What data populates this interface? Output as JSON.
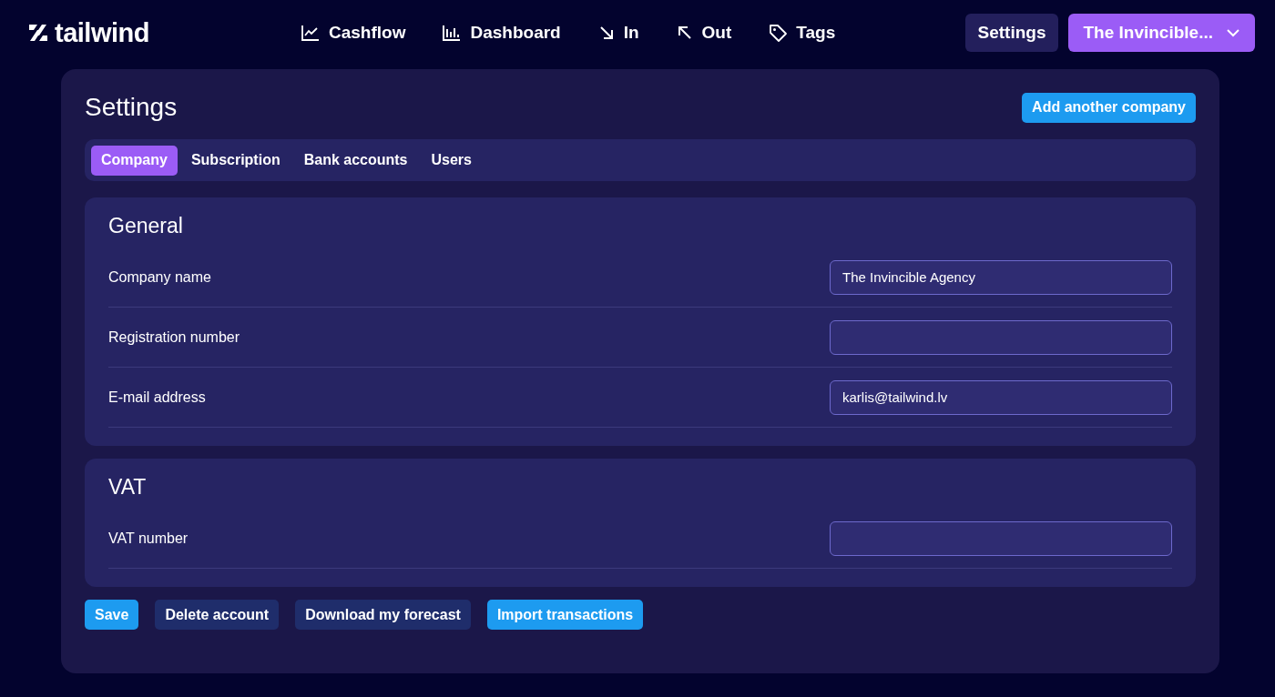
{
  "logo": {
    "text": "tailwind"
  },
  "nav": [
    {
      "label": "Cashflow",
      "kind": "line"
    },
    {
      "label": "Dashboard",
      "kind": "bars"
    },
    {
      "label": "In",
      "kind": "down"
    },
    {
      "label": "Out",
      "kind": "up"
    },
    {
      "label": "Tags",
      "kind": "tag"
    }
  ],
  "header_buttons": [
    {
      "label": "Settings",
      "kind": "dark"
    },
    {
      "label": "The Invincible...",
      "kind": "menu"
    }
  ],
  "page": {
    "title": "Settings",
    "action": "Add another company"
  },
  "tabs": [
    {
      "label": "Company",
      "selected": true
    },
    {
      "label": "Subscription",
      "selected": false
    },
    {
      "label": "Bank accounts",
      "selected": false
    },
    {
      "label": "Users",
      "selected": false
    }
  ],
  "sections": [
    {
      "title": "General",
      "fields": [
        {
          "label": "Company name",
          "value": "The Invincible Agency"
        },
        {
          "label": "Registration number"
        },
        {
          "label": "E-mail address",
          "value": "karlis@tailwind.lv"
        }
      ]
    },
    {
      "title": "VAT",
      "fields": [
        {
          "label": "VAT number"
        }
      ]
    }
  ],
  "buttons": [
    {
      "label": "Save",
      "kind": "primary"
    },
    {
      "label": "Delete account",
      "kind": "secondary"
    },
    {
      "label": "Download my forecast",
      "kind": "secondary"
    },
    {
      "label": "Import transactions",
      "kind": "primary"
    }
  ]
}
